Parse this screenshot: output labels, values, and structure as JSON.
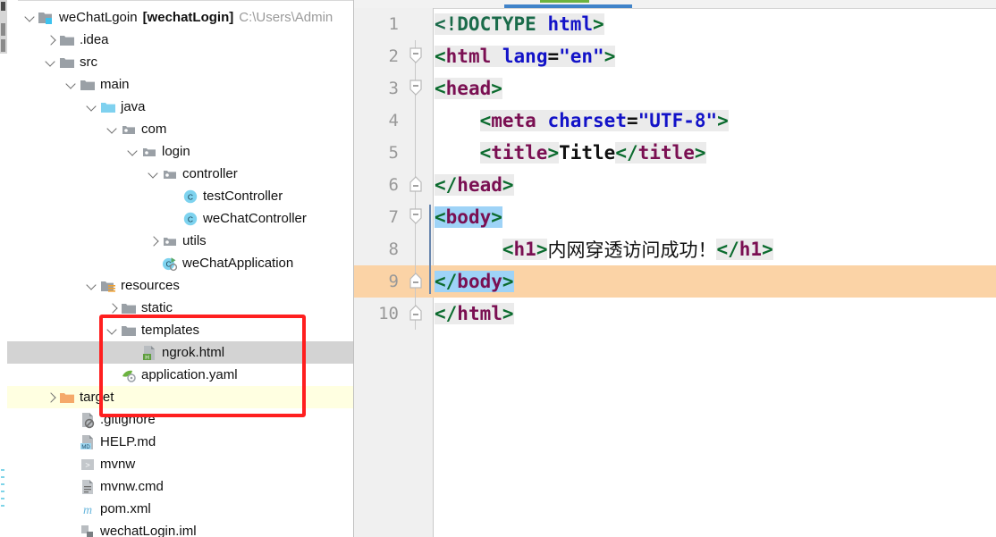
{
  "project_panel": {
    "tree": [
      {
        "indent": 0,
        "arrow": "down",
        "icon": "module-folder-icon",
        "label": "weChatLgoin",
        "bracket": "[wechatLogin]",
        "path": "C:\\Users\\Admin",
        "state": "normal"
      },
      {
        "indent": 1,
        "arrow": "right",
        "icon": "folder-icon",
        "label": ".idea",
        "state": "normal"
      },
      {
        "indent": 1,
        "arrow": "down",
        "icon": "folder-icon",
        "label": "src",
        "state": "normal"
      },
      {
        "indent": 2,
        "arrow": "down",
        "icon": "folder-icon",
        "label": "main",
        "state": "normal"
      },
      {
        "indent": 3,
        "arrow": "down",
        "icon": "source-folder-icon",
        "label": "java",
        "state": "normal"
      },
      {
        "indent": 4,
        "arrow": "down",
        "icon": "package-icon",
        "label": "com",
        "state": "normal"
      },
      {
        "indent": 5,
        "arrow": "down",
        "icon": "package-icon",
        "label": "login",
        "state": "normal"
      },
      {
        "indent": 6,
        "arrow": "down",
        "icon": "package-icon",
        "label": "controller",
        "state": "normal"
      },
      {
        "indent": 7,
        "arrow": "none",
        "icon": "java-class-icon",
        "label": "testController",
        "state": "normal"
      },
      {
        "indent": 7,
        "arrow": "none",
        "icon": "java-class-icon",
        "label": "weChatController",
        "state": "normal"
      },
      {
        "indent": 6,
        "arrow": "right",
        "icon": "package-icon",
        "label": "utils",
        "state": "normal"
      },
      {
        "indent": 6,
        "arrow": "none",
        "icon": "spring-boot-app-icon",
        "label": "weChatApplication",
        "state": "normal"
      },
      {
        "indent": 3,
        "arrow": "down",
        "icon": "resources-folder-icon",
        "label": "resources",
        "state": "normal"
      },
      {
        "indent": 4,
        "arrow": "right",
        "icon": "folder-icon",
        "label": "static",
        "state": "normal"
      },
      {
        "indent": 4,
        "arrow": "down",
        "icon": "folder-icon",
        "label": "templates",
        "state": "normal"
      },
      {
        "indent": 5,
        "arrow": "none",
        "icon": "html-file-icon",
        "label": "ngrok.html",
        "state": "selected"
      },
      {
        "indent": 4,
        "arrow": "none",
        "icon": "yaml-file-icon",
        "label": "application.yaml",
        "state": "normal"
      },
      {
        "indent": 1,
        "arrow": "right",
        "icon": "target-folder-icon",
        "label": "target",
        "state": "highlighted"
      },
      {
        "indent": 2,
        "arrow": "none",
        "icon": "gitignore-file-icon",
        "label": ".gitignore",
        "state": "normal"
      },
      {
        "indent": 2,
        "arrow": "none",
        "icon": "markdown-file-icon",
        "label": "HELP.md",
        "state": "normal"
      },
      {
        "indent": 2,
        "arrow": "none",
        "icon": "shell-file-icon",
        "label": "mvnw",
        "state": "normal"
      },
      {
        "indent": 2,
        "arrow": "none",
        "icon": "cmd-file-icon",
        "label": "mvnw.cmd",
        "state": "normal"
      },
      {
        "indent": 2,
        "arrow": "none",
        "icon": "maven-file-icon",
        "label": "pom.xml",
        "state": "normal"
      },
      {
        "indent": 2,
        "arrow": "none",
        "icon": "iml-file-icon",
        "label": "wechatLogin.iml",
        "state": "normal"
      }
    ],
    "annotation": {
      "name": "red-highlight-box",
      "color": "#ff1f1f"
    }
  },
  "editor": {
    "current_line": 9,
    "lines": [
      {
        "num": "1",
        "fold": "none",
        "indent_guide": false,
        "segments": [
          {
            "t": "<!DOCTYPE ",
            "c": "tok-doct",
            "bg": "seg-bg"
          },
          {
            "t": "html",
            "c": "tok-attr",
            "bg": "seg-bg"
          },
          {
            "t": ">",
            "c": "tok-br",
            "bg": "seg-bg"
          }
        ]
      },
      {
        "num": "2",
        "fold": "open",
        "indent_guide": false,
        "segments": [
          {
            "t": "<",
            "c": "tok-br",
            "bg": "seg-bg"
          },
          {
            "t": "html",
            "c": "tok-tag",
            "bg": "seg-bg"
          },
          {
            "t": " ",
            "c": "tok-plain",
            "bg": "seg-bg"
          },
          {
            "t": "lang",
            "c": "tok-attr",
            "bg": "seg-bg"
          },
          {
            "t": "=",
            "c": "tok-plain",
            "bg": "seg-bg"
          },
          {
            "t": "\"en\"",
            "c": "tok-str",
            "bg": "seg-bg"
          },
          {
            "t": ">",
            "c": "tok-br",
            "bg": "seg-bg"
          }
        ]
      },
      {
        "num": "3",
        "fold": "open",
        "indent_guide": false,
        "segments": [
          {
            "t": "<",
            "c": "tok-br",
            "bg": "seg-bg"
          },
          {
            "t": "head",
            "c": "tok-tag",
            "bg": "seg-bg"
          },
          {
            "t": ">",
            "c": "tok-br",
            "bg": "seg-bg"
          }
        ]
      },
      {
        "num": "4",
        "fold": "none",
        "indent_guide": false,
        "segments": [
          {
            "t": "    ",
            "c": "tok-plain",
            "bg": ""
          },
          {
            "t": "<",
            "c": "tok-br",
            "bg": "seg-bg"
          },
          {
            "t": "meta",
            "c": "tok-tag",
            "bg": "seg-bg"
          },
          {
            "t": " ",
            "c": "tok-plain",
            "bg": "seg-bg"
          },
          {
            "t": "charset",
            "c": "tok-attr",
            "bg": "seg-bg"
          },
          {
            "t": "=",
            "c": "tok-plain",
            "bg": "seg-bg"
          },
          {
            "t": "\"UTF-8\"",
            "c": "tok-str",
            "bg": "seg-bg"
          },
          {
            "t": ">",
            "c": "tok-br",
            "bg": "seg-bg"
          }
        ]
      },
      {
        "num": "5",
        "fold": "none",
        "indent_guide": false,
        "segments": [
          {
            "t": "    ",
            "c": "tok-plain",
            "bg": ""
          },
          {
            "t": "<",
            "c": "tok-br",
            "bg": "seg-bg"
          },
          {
            "t": "title",
            "c": "tok-tag",
            "bg": "seg-bg"
          },
          {
            "t": ">",
            "c": "tok-br",
            "bg": "seg-bg"
          },
          {
            "t": "Title",
            "c": "tok-plain",
            "bg": ""
          },
          {
            "t": "</",
            "c": "tok-br",
            "bg": "seg-bg"
          },
          {
            "t": "title",
            "c": "tok-tag",
            "bg": "seg-bg"
          },
          {
            "t": ">",
            "c": "tok-br",
            "bg": "seg-bg"
          }
        ]
      },
      {
        "num": "6",
        "fold": "close",
        "indent_guide": false,
        "segments": [
          {
            "t": "</",
            "c": "tok-br",
            "bg": "seg-bg"
          },
          {
            "t": "head",
            "c": "tok-tag",
            "bg": "seg-bg"
          },
          {
            "t": ">",
            "c": "tok-br",
            "bg": "seg-bg"
          }
        ]
      },
      {
        "num": "7",
        "fold": "open",
        "indent_guide": true,
        "segments": [
          {
            "t": "<",
            "c": "tok-br",
            "bg": "seg-sel"
          },
          {
            "t": "body",
            "c": "tok-tag",
            "bg": "seg-sel"
          },
          {
            "t": ">",
            "c": "tok-br",
            "bg": "seg-sel"
          }
        ]
      },
      {
        "num": "8",
        "fold": "none",
        "indent_guide": true,
        "segments": [
          {
            "t": "      ",
            "c": "tok-plain",
            "bg": ""
          },
          {
            "t": "<",
            "c": "tok-br",
            "bg": "seg-bg"
          },
          {
            "t": "h1",
            "c": "tok-tag",
            "bg": "seg-bg"
          },
          {
            "t": ">",
            "c": "tok-br",
            "bg": "seg-bg"
          },
          {
            "t": "内网穿透访问成功！",
            "c": "tok-cjk",
            "bg": ""
          },
          {
            "t": "</",
            "c": "tok-br",
            "bg": "seg-bg"
          },
          {
            "t": "h1",
            "c": "tok-tag",
            "bg": "seg-bg"
          },
          {
            "t": ">",
            "c": "tok-br",
            "bg": "seg-bg"
          }
        ]
      },
      {
        "num": "9",
        "fold": "close",
        "indent_guide": true,
        "current": true,
        "segments": [
          {
            "t": "</",
            "c": "tok-br",
            "bg": "seg-sel"
          },
          {
            "t": "body",
            "c": "tok-tag",
            "bg": "seg-sel"
          },
          {
            "t": ">",
            "c": "tok-br",
            "bg": "seg-sel"
          }
        ]
      },
      {
        "num": "10",
        "fold": "close",
        "indent_guide": false,
        "segments": [
          {
            "t": "</",
            "c": "tok-br",
            "bg": "seg-bg"
          },
          {
            "t": "html",
            "c": "tok-tag",
            "bg": "seg-bg"
          },
          {
            "t": ">",
            "c": "tok-br",
            "bg": "seg-bg"
          }
        ]
      }
    ],
    "colors": {
      "current_line_bg": "#fbd3a6",
      "selection_bg": "#9ed3f7",
      "token_bg": "#ebebeb",
      "gutter_bg": "#f0f0f0",
      "tab_accent": "#4083c9"
    }
  }
}
